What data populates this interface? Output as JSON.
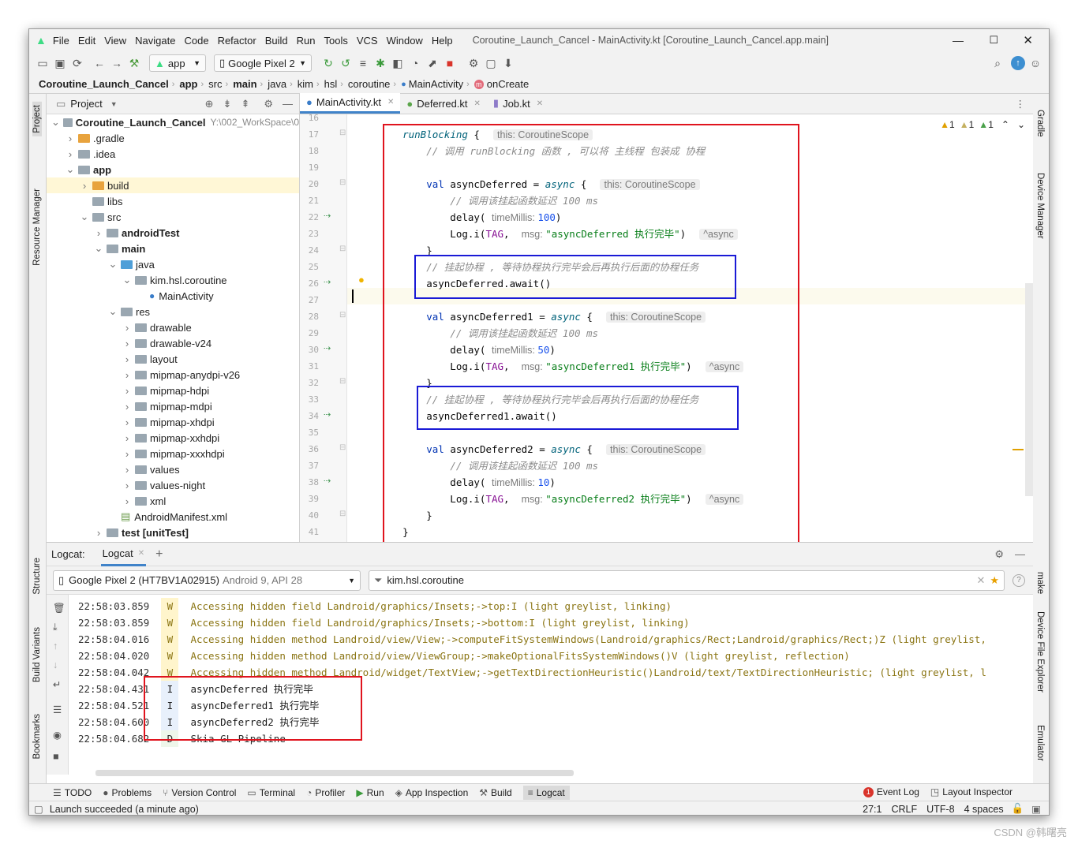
{
  "window": {
    "title": "Coroutine_Launch_Cancel - MainActivity.kt [Coroutine_Launch_Cancel.app.main]",
    "menu": [
      "File",
      "Edit",
      "View",
      "Navigate",
      "Code",
      "Refactor",
      "Build",
      "Run",
      "Tools",
      "VCS",
      "Window",
      "Help"
    ]
  },
  "toolbar": {
    "run_config": "app",
    "device": "Google Pixel 2"
  },
  "breadcrumb": [
    "Coroutine_Launch_Cancel",
    "app",
    "src",
    "main",
    "java",
    "kim",
    "hsl",
    "coroutine",
    "MainActivity",
    "onCreate"
  ],
  "left_strip": [
    "Project",
    "Resource Manager",
    "Structure",
    "Build Variants",
    "Bookmarks"
  ],
  "right_strip": [
    "Gradle",
    "Device Manager",
    "make",
    "Device File Explorer",
    "Emulator"
  ],
  "project": {
    "header": "Project",
    "root": "Coroutine_Launch_Cancel",
    "root_path": "Y:\\002_WorkSpace\\0",
    "items": [
      {
        "label": "Coroutine_Launch_Cancel",
        "depth": 0,
        "arrow": "v",
        "type": "module",
        "bold": true
      },
      {
        "label": ".gradle",
        "depth": 1,
        "arrow": ">",
        "type": "orange"
      },
      {
        "label": ".idea",
        "depth": 1,
        "arrow": ">",
        "type": "plain"
      },
      {
        "label": "app",
        "depth": 1,
        "arrow": "v",
        "type": "module",
        "bold": true
      },
      {
        "label": "build",
        "depth": 2,
        "arrow": ">",
        "type": "orange",
        "selected": true
      },
      {
        "label": "libs",
        "depth": 2,
        "arrow": "",
        "type": "plain"
      },
      {
        "label": "src",
        "depth": 2,
        "arrow": "v",
        "type": "plain"
      },
      {
        "label": "androidTest",
        "depth": 3,
        "arrow": ">",
        "type": "plain",
        "bold": true
      },
      {
        "label": "main",
        "depth": 3,
        "arrow": "v",
        "type": "plain",
        "bold": true
      },
      {
        "label": "java",
        "depth": 4,
        "arrow": "v",
        "type": "blue"
      },
      {
        "label": "kim.hsl.coroutine",
        "depth": 5,
        "arrow": "v",
        "type": "plain"
      },
      {
        "label": "MainActivity",
        "depth": 6,
        "arrow": "",
        "type": "kotlin"
      },
      {
        "label": "res",
        "depth": 4,
        "arrow": "v",
        "type": "plain"
      },
      {
        "label": "drawable",
        "depth": 5,
        "arrow": ">",
        "type": "plain"
      },
      {
        "label": "drawable-v24",
        "depth": 5,
        "arrow": ">",
        "type": "plain"
      },
      {
        "label": "layout",
        "depth": 5,
        "arrow": ">",
        "type": "plain"
      },
      {
        "label": "mipmap-anydpi-v26",
        "depth": 5,
        "arrow": ">",
        "type": "plain"
      },
      {
        "label": "mipmap-hdpi",
        "depth": 5,
        "arrow": ">",
        "type": "plain"
      },
      {
        "label": "mipmap-mdpi",
        "depth": 5,
        "arrow": ">",
        "type": "plain"
      },
      {
        "label": "mipmap-xhdpi",
        "depth": 5,
        "arrow": ">",
        "type": "plain"
      },
      {
        "label": "mipmap-xxhdpi",
        "depth": 5,
        "arrow": ">",
        "type": "plain"
      },
      {
        "label": "mipmap-xxxhdpi",
        "depth": 5,
        "arrow": ">",
        "type": "plain"
      },
      {
        "label": "values",
        "depth": 5,
        "arrow": ">",
        "type": "plain"
      },
      {
        "label": "values-night",
        "depth": 5,
        "arrow": ">",
        "type": "plain"
      },
      {
        "label": "xml",
        "depth": 5,
        "arrow": ">",
        "type": "plain"
      },
      {
        "label": "AndroidManifest.xml",
        "depth": 4,
        "arrow": "",
        "type": "manifest"
      },
      {
        "label": "test [unitTest]",
        "depth": 3,
        "arrow": ">",
        "type": "plain",
        "bold": true
      }
    ]
  },
  "editor": {
    "tabs": [
      {
        "label": "MainActivity.kt",
        "active": true
      },
      {
        "label": "Deferred.kt",
        "active": false
      },
      {
        "label": "Job.kt",
        "active": false
      }
    ],
    "inspections": {
      "warn1": "1",
      "warn2": "1",
      "warn3": "1"
    },
    "line_numbers": [
      "16",
      "17",
      "18",
      "19",
      "20",
      "21",
      "22",
      "23",
      "24",
      "25",
      "26",
      "27",
      "28",
      "29",
      "30",
      "31",
      "32",
      "33",
      "34",
      "35",
      "36",
      "37",
      "38",
      "39",
      "40",
      "41"
    ],
    "lines": [
      {
        "n": "16",
        "html": ""
      },
      {
        "n": "17",
        "html": "    <span class='fn'>runBlocking</span> {  <span class='hint'>this: CoroutineScope</span>"
      },
      {
        "n": "18",
        "html": "        <span class='cm'>// 调用 runBlocking 函数 , 可以将 主线程 包装成 协程</span>"
      },
      {
        "n": "19",
        "html": ""
      },
      {
        "n": "20",
        "html": "        <span class='kw'>val</span> asyncDeferred = <span class='fn'>async</span> {  <span class='hint'>this: CoroutineScope</span>"
      },
      {
        "n": "21",
        "html": "            <span class='cm'>// 调用该挂起函数延迟 100 ms</span>"
      },
      {
        "n": "22",
        "html": "            delay( <span class='param'>timeMillis: </span><span class='num'>100</span>)"
      },
      {
        "n": "23",
        "html": "            Log.i(<span class='tag'>TAG</span>,  <span class='param'>msg: </span><span class='str'>\"asyncDeferred 执行完毕\"</span>)  <span class='hint'>^async</span>"
      },
      {
        "n": "24",
        "html": "        }"
      },
      {
        "n": "25",
        "html": "        <span class='cm'>// 挂起协程 , 等待协程执行完毕会后再执行后面的协程任务</span>"
      },
      {
        "n": "26",
        "html": "        asyncDeferred.await()"
      },
      {
        "n": "27",
        "html": ""
      },
      {
        "n": "28",
        "html": "        <span class='kw'>val</span> asyncDeferred1 = <span class='fn'>async</span> {  <span class='hint'>this: CoroutineScope</span>"
      },
      {
        "n": "29",
        "html": "            <span class='cm'>// 调用该挂起函数延迟 100 ms</span>"
      },
      {
        "n": "30",
        "html": "            delay( <span class='param'>timeMillis: </span><span class='num'>50</span>)"
      },
      {
        "n": "31",
        "html": "            Log.i(<span class='tag'>TAG</span>,  <span class='param'>msg: </span><span class='str'>\"asyncDeferred1 执行完毕\"</span>)  <span class='hint'>^async</span>"
      },
      {
        "n": "32",
        "html": "        }"
      },
      {
        "n": "33",
        "html": "        <span class='cm'>// 挂起协程 , 等待协程执行完毕会后再执行后面的协程任务</span>"
      },
      {
        "n": "34",
        "html": "        asyncDeferred1.await()"
      },
      {
        "n": "35",
        "html": ""
      },
      {
        "n": "36",
        "html": "        <span class='kw'>val</span> asyncDeferred2 = <span class='fn'>async</span> {  <span class='hint'>this: CoroutineScope</span>"
      },
      {
        "n": "37",
        "html": "            <span class='cm'>// 调用该挂起函数延迟 100 ms</span>"
      },
      {
        "n": "38",
        "html": "            delay( <span class='param'>timeMillis: </span><span class='num'>10</span>)"
      },
      {
        "n": "39",
        "html": "            Log.i(<span class='tag'>TAG</span>,  <span class='param'>msg: </span><span class='str'>\"asyncDeferred2 执行完毕\"</span>)  <span class='hint'>^async</span>"
      },
      {
        "n": "40",
        "html": "        }"
      },
      {
        "n": "41",
        "html": "    }"
      }
    ]
  },
  "logcat": {
    "title": "Logcat:",
    "tab": "Logcat",
    "device": "Google Pixel 2 (HT7BV1A02915)",
    "device_meta": "Android 9, API 28",
    "filter": "kim.hsl.coroutine",
    "rows": [
      {
        "time": "22:58:03.859",
        "level": "W",
        "msg": "Accessing hidden field Landroid/graphics/Insets;->top:I (light greylist, linking)"
      },
      {
        "time": "22:58:03.859",
        "level": "W",
        "msg": "Accessing hidden field Landroid/graphics/Insets;->bottom:I (light greylist, linking)"
      },
      {
        "time": "22:58:04.016",
        "level": "W",
        "msg": "Accessing hidden method Landroid/view/View;->computeFitSystemWindows(Landroid/graphics/Rect;Landroid/graphics/Rect;)Z (light greylist,"
      },
      {
        "time": "22:58:04.020",
        "level": "W",
        "msg": "Accessing hidden method Landroid/view/ViewGroup;->makeOptionalFitsSystemWindows()V (light greylist, reflection)"
      },
      {
        "time": "22:58:04.042",
        "level": "W",
        "msg": "Accessing hidden method Landroid/widget/TextView;->getTextDirectionHeuristic()Landroid/text/TextDirectionHeuristic; (light greylist, l"
      },
      {
        "time": "22:58:04.431",
        "level": "I",
        "msg": "asyncDeferred 执行完毕"
      },
      {
        "time": "22:58:04.521",
        "level": "I",
        "msg": "asyncDeferred1 执行完毕"
      },
      {
        "time": "22:58:04.600",
        "level": "I",
        "msg": "asyncDeferred2 执行完毕"
      },
      {
        "time": "22:58:04.682",
        "level": "D",
        "msg": "Skia GL Pipeline"
      }
    ]
  },
  "bottom_tools": {
    "left": [
      "TODO",
      "Problems",
      "Version Control",
      "Terminal",
      "Profiler",
      "Run",
      "App Inspection",
      "Build",
      "Logcat"
    ],
    "right": [
      "Event Log",
      "Layout Inspector"
    ],
    "event_count": "1"
  },
  "status": {
    "message": "Launch succeeded (a minute ago)",
    "position": "27:1",
    "line_sep": "CRLF",
    "encoding": "UTF-8",
    "indent": "4 spaces"
  },
  "watermark": "CSDN @韩曙亮",
  "colors": {
    "annotation_red": "#e0141e",
    "annotation_blue": "#1a1ad6",
    "selection": "#fff7d6"
  }
}
